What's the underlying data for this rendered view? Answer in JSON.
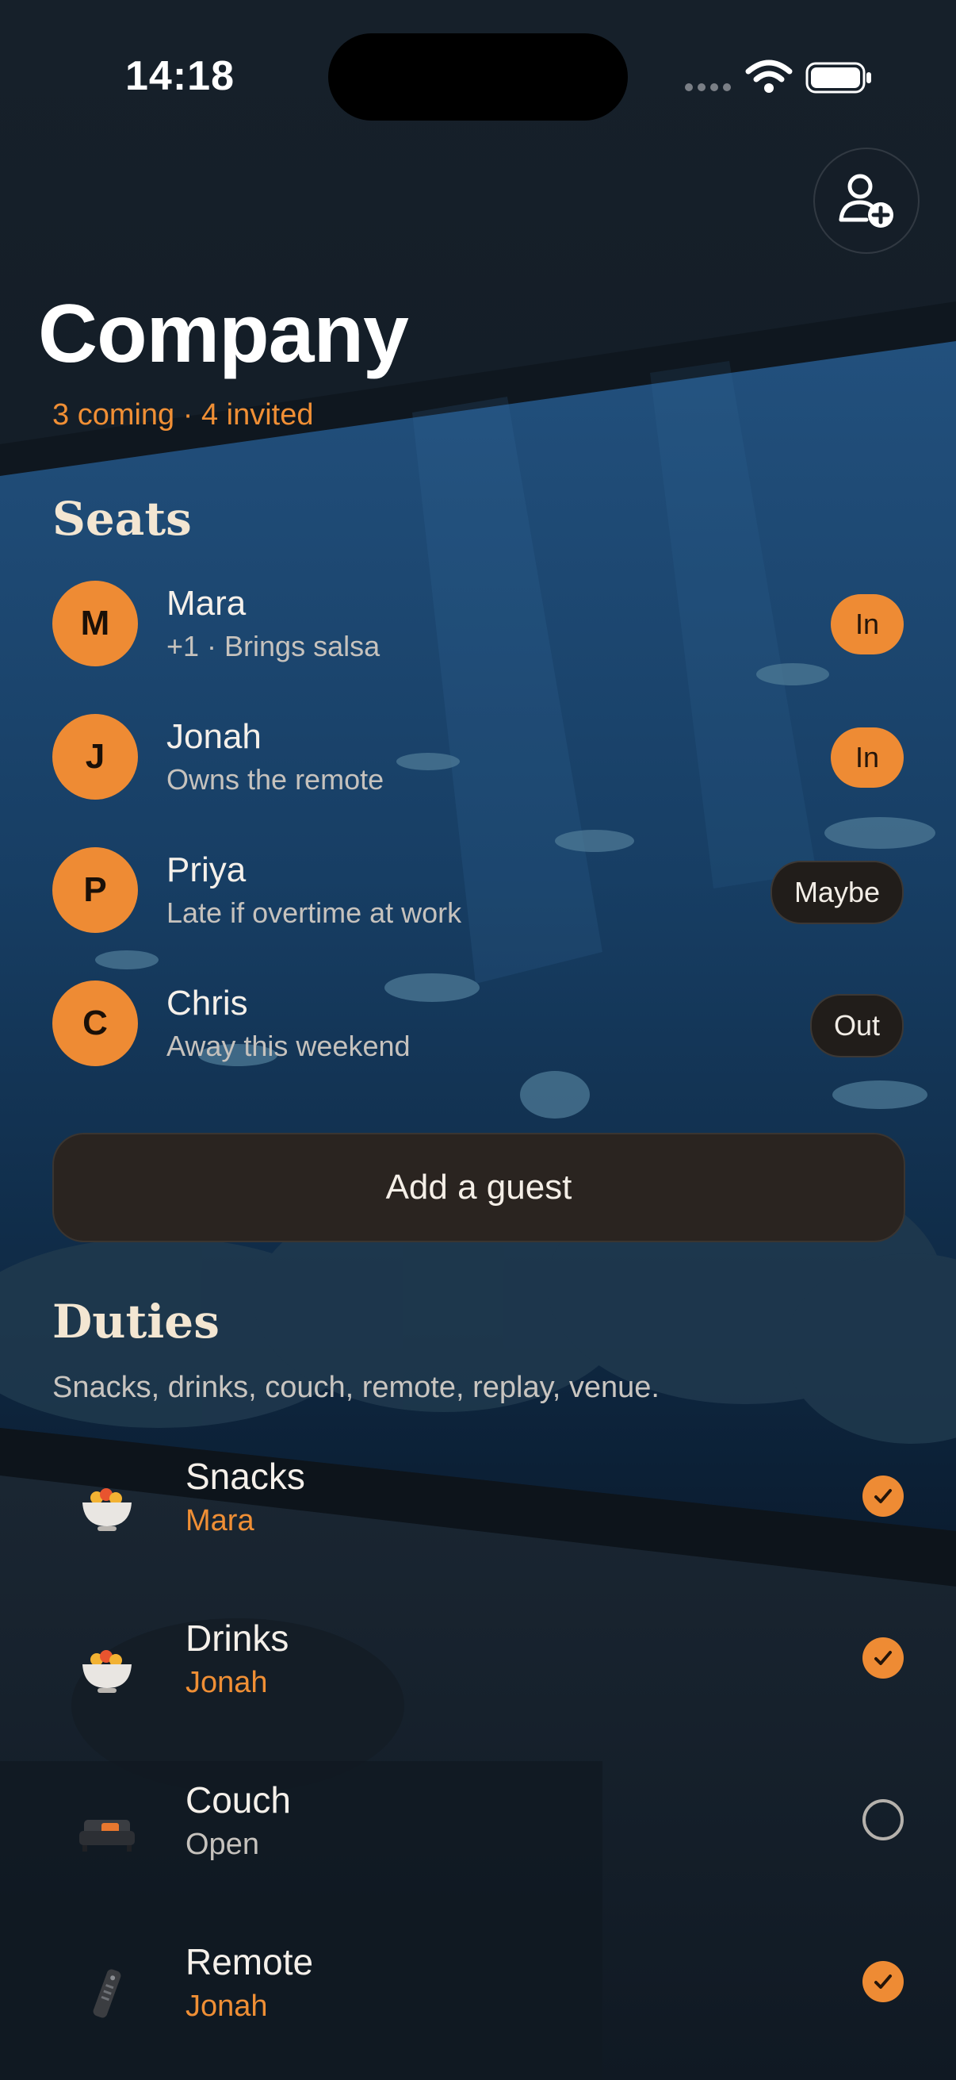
{
  "status_bar": {
    "time": "14:18"
  },
  "header": {
    "title": "Company",
    "summary": "3 coming · 4 invited",
    "add_person_icon": "person-add-icon"
  },
  "seats": {
    "title": "Seats",
    "guests": [
      {
        "initial": "M",
        "name": "Mara",
        "note": "+1 · Brings salsa",
        "status": "In"
      },
      {
        "initial": "J",
        "name": "Jonah",
        "note": "Owns the remote",
        "status": "In"
      },
      {
        "initial": "P",
        "name": "Priya",
        "note": "Late if overtime at work",
        "status": "Maybe"
      },
      {
        "initial": "C",
        "name": "Chris",
        "note": "Away this weekend",
        "status": "Out"
      }
    ],
    "add_guest_label": "Add a guest"
  },
  "duties": {
    "title": "Duties",
    "subtitle": "Snacks, drinks, couch, remote, replay, venue.",
    "items": [
      {
        "name": "Snacks",
        "owner": "Mara",
        "done": true,
        "icon": "snack-bowl-icon"
      },
      {
        "name": "Drinks",
        "owner": "Jonah",
        "done": true,
        "icon": "snack-bowl-icon"
      },
      {
        "name": "Couch",
        "owner": "Open",
        "done": false,
        "icon": "couch-icon"
      },
      {
        "name": "Remote",
        "owner": "Jonah",
        "done": true,
        "icon": "remote-icon"
      }
    ]
  },
  "colors": {
    "accent": "#ee8b34",
    "background": "#0f1822"
  }
}
